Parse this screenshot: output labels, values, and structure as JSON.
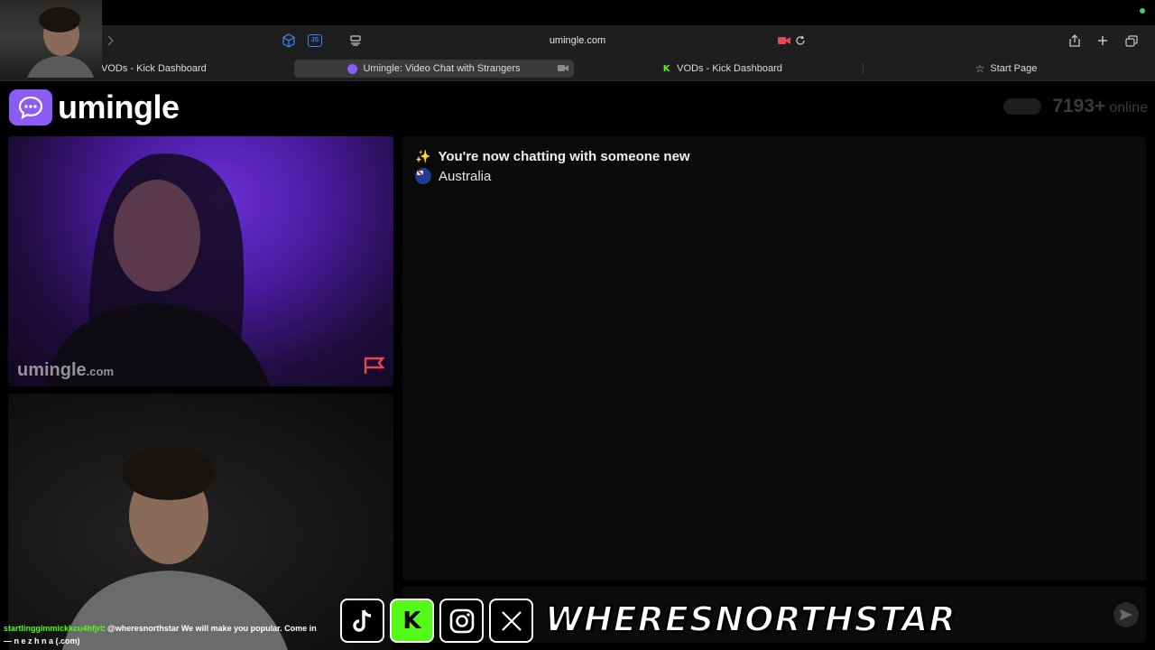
{
  "browser": {
    "url": "umingle.com",
    "tabs": [
      {
        "label": "VODs - Kick Dashboard",
        "favicon": "kick-icon"
      },
      {
        "label": "Umingle: Video Chat with Strangers",
        "favicon": "umingle-icon",
        "active": true
      },
      {
        "label": "VODs - Kick Dashboard",
        "favicon": "kick-icon"
      },
      {
        "label": "Start Page",
        "favicon": "star-icon"
      }
    ],
    "ext_label": "JS"
  },
  "site": {
    "logo_text": "umingle",
    "online_count": "7193+",
    "online_label": "online",
    "accent": "#8b5cf6"
  },
  "stranger_video": {
    "watermark": "umingle",
    "watermark_suffix": ".com"
  },
  "chat": {
    "status": "You're now chatting with someone new",
    "country": "Australia"
  },
  "overlay": {
    "chat_user": "startlinggimmickkcu4hfjrl",
    "chat_message": ": @wheresnorthstar We will make you popular. Come in",
    "chat_line2": "— n e z h n a (.com)",
    "handle": "WHERESNORTHSTAR"
  }
}
